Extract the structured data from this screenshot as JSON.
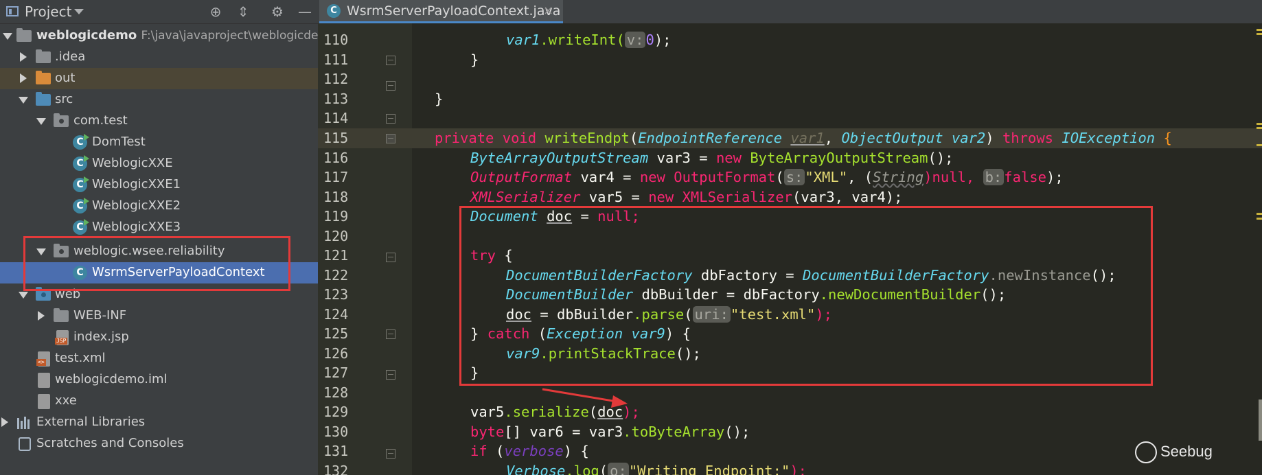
{
  "project_panel": {
    "title": "Project",
    "tree": [
      {
        "label": "weblogicdemo",
        "path": "F:\\java\\javaproject\\weblogicdem"
      },
      {
        "label": ".idea"
      },
      {
        "label": "out"
      },
      {
        "label": "src"
      },
      {
        "label": "com.test"
      },
      {
        "label": "DomTest"
      },
      {
        "label": "WeblogicXXE"
      },
      {
        "label": "WeblogicXXE1"
      },
      {
        "label": "WeblogicXXE2"
      },
      {
        "label": "WeblogicXXE3"
      },
      {
        "label": "weblogic.wsee.reliability"
      },
      {
        "label": "WsrmServerPayloadContext"
      },
      {
        "label": "web"
      },
      {
        "label": "WEB-INF"
      },
      {
        "label": "index.jsp"
      },
      {
        "label": "test.xml"
      },
      {
        "label": "weblogicdemo.iml"
      },
      {
        "label": "xxe"
      },
      {
        "label": "External Libraries"
      },
      {
        "label": "Scratches and Consoles"
      }
    ]
  },
  "tab": {
    "label": "WsrmServerPayloadContext.java",
    "icon": "C",
    "close": "×"
  },
  "editor": {
    "line_numbers": [
      "110",
      "111",
      "112",
      "113",
      "114",
      "115",
      "116",
      "117",
      "118",
      "119",
      "120",
      "121",
      "122",
      "123",
      "124",
      "125",
      "126",
      "127",
      "128",
      "129",
      "130",
      "131",
      "132"
    ],
    "hints": {
      "v": "v:",
      "s": "s:",
      "b": "b:",
      "uri": "uri:",
      "o": "o:"
    },
    "tokens": {
      "l110_var": "var1",
      "l110_fn": ".writeInt(",
      "l110_num": "0",
      "l110_end": ");",
      "l111": "}",
      "l113": "}",
      "l115_a": "private void ",
      "l115_fn": "writeEndpt",
      "l115_p": "(",
      "l115_t1": "EndpointReference",
      "l115_v1": "var1",
      "l115_c": ", ",
      "l115_t2": "ObjectOutput",
      "l115_v2": "var2",
      "l115_cl": ") ",
      "l115_th": "throws ",
      "l115_t3": "IOException",
      "l115_br": " {",
      "l116_t": "ByteArrayOutputStream",
      "l116_v": " var3 = ",
      "l116_new": "new ",
      "l116_fn": "ByteArrayOutputStream",
      "l116_end": "();",
      "l117_t": "OutputFormat",
      "l117_v": " var4 = ",
      "l117_new": "new ",
      "l117_fn": "OutputFormat",
      "l117_p": "(",
      "l117_s": "\"XML\"",
      "l117_m": ", (",
      "l117_str": "String",
      "l117_null": ")null, ",
      "l117_false": "false",
      "l117_end": ");",
      "l118_t": "XMLSerializer",
      "l118_v": " var5 = ",
      "l118_new": "new ",
      "l118_fn": "XMLSerializer",
      "l118_end": "(var3, var4);",
      "l119_t": "Document",
      "l119_sp": " ",
      "l119_doc": "doc",
      "l119_eq": " = ",
      "l119_null": "null",
      "l119_end": ";",
      "l121_try": "try",
      "l121_br": " {",
      "l122_t": "DocumentBuilderFactory",
      "l122_v": " dbFactory = ",
      "l122_t2": "DocumentBuilderFactory",
      "l122_fn": ".newInstance",
      "l122_end": "();",
      "l123_t": "DocumentBuilder",
      "l123_v": " dbBuilder = dbFactory",
      "l123_fn": ".newDocumentBuilder",
      "l123_end": "();",
      "l124_doc": "doc",
      "l124_v": " = dbBuilder",
      "l124_fn": ".parse",
      "l124_p": "(",
      "l124_s": "\"test.xml\"",
      "l124_end": ");",
      "l125_a": "} ",
      "l125_catch": "catch",
      "l125_p": " (",
      "l125_t": "Exception",
      "l125_v": " var9",
      "l125_end": ") {",
      "l126_v": "var9",
      "l126_fn": ".printStackTrace",
      "l126_end": "();",
      "l127": "}",
      "l129_v": "var5",
      "l129_fn": ".serialize",
      "l129_p": "(",
      "l129_doc": "doc",
      "l129_end": ");",
      "l130_kw": "byte",
      "l130_v": "[] var6 = var3",
      "l130_fn": ".toByteArray",
      "l130_end": "();",
      "l131_if": "if",
      "l131_p": " (",
      "l131_v": "verbose",
      "l131_end": ") {",
      "l132_t": "Verbose",
      "l132_fn": ".log",
      "l132_p": "(",
      "l132_s": "\"Writing Endpoint:\"",
      "l132_end": ");"
    }
  },
  "watermark": {
    "text": "Seebug"
  },
  "colors": {
    "keyword": "#f92672",
    "type": "#66d9ef",
    "function": "#a6e22e",
    "string": "#e6db74",
    "number": "#ae81ff",
    "annotation_box": "#e33a3a",
    "selection": "#4b6eaf"
  }
}
